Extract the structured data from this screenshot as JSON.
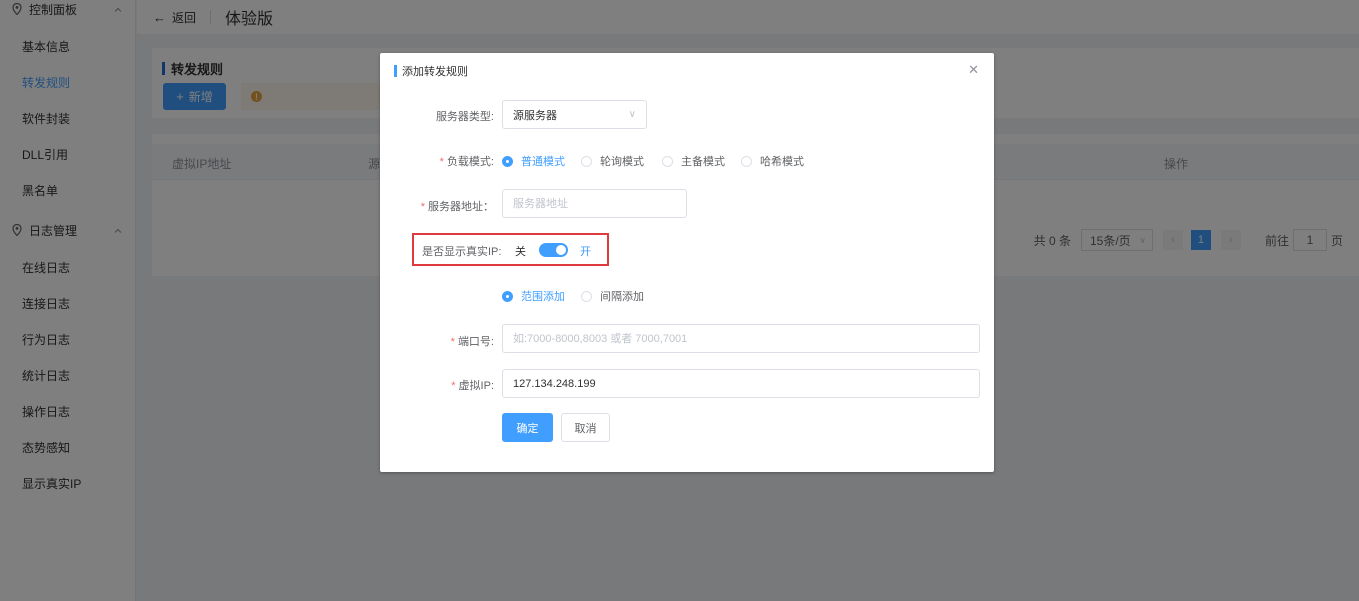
{
  "sidebar": {
    "groups": [
      {
        "label": "控制面板"
      },
      {
        "label": "日志管理"
      }
    ],
    "control_items": [
      {
        "label": "基本信息"
      },
      {
        "label": "转发规则"
      },
      {
        "label": "软件封装"
      },
      {
        "label": "DLL引用"
      },
      {
        "label": "黑名单"
      }
    ],
    "log_items": [
      {
        "label": "在线日志"
      },
      {
        "label": "连接日志"
      },
      {
        "label": "行为日志"
      },
      {
        "label": "统计日志"
      },
      {
        "label": "操作日志"
      },
      {
        "label": "态势感知"
      },
      {
        "label": "显示真实IP"
      }
    ]
  },
  "topbar": {
    "back_label": "返回",
    "title": "体验版"
  },
  "card": {
    "title": "转发规则",
    "add_button": "新增"
  },
  "table": {
    "columns": [
      "虚拟IP地址",
      "源",
      "操作"
    ],
    "pager": {
      "total": "共 0 条",
      "page_size": "15条/页",
      "current": "1",
      "goto_label": "前往",
      "goto_value": "1",
      "page_unit": "页"
    }
  },
  "dialog": {
    "title": "添加转发规则",
    "server_type": {
      "label": "服务器类型:",
      "value": "源服务器"
    },
    "load_mode": {
      "label": "负载模式:",
      "options": [
        "普通模式",
        "轮询模式",
        "主备模式",
        "哈希模式"
      ],
      "selected": "普通模式"
    },
    "server_addr": {
      "label": "服务器地址：",
      "placeholder": "服务器地址"
    },
    "real_ip": {
      "label": "是否显示真实IP:",
      "off": "关",
      "on": "开"
    },
    "add_mode": {
      "options": [
        "范围添加",
        "间隔添加"
      ],
      "selected": "范围添加"
    },
    "port": {
      "label": "端口号:",
      "placeholder": "如:7000-8000,8003 或者 7000,7001"
    },
    "virtual_ip": {
      "label": "虚拟IP:",
      "value": "127.134.248.199"
    },
    "ok_button": "确定",
    "cancel_button": "取消"
  },
  "colors": {
    "primary": "#409eff",
    "highlight": "#e0393e",
    "warning": "#e6a23c",
    "required": "#f56c6c"
  }
}
